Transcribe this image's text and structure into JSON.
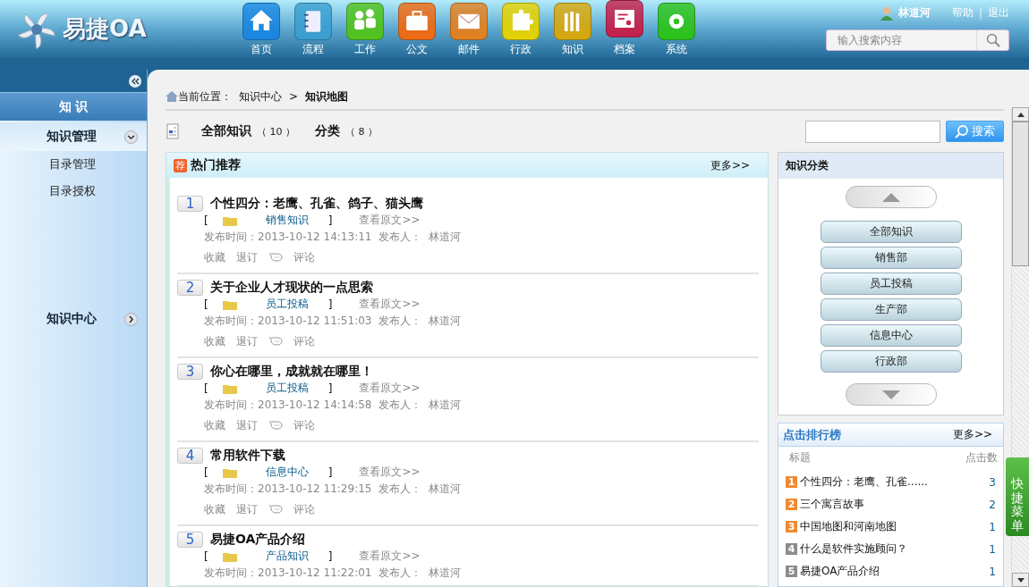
{
  "logo": {
    "text": "易捷OA"
  },
  "nav": [
    {
      "label": "首页",
      "color": "#1b86e0",
      "selected": false
    },
    {
      "label": "流程",
      "color": "#3a9fd0",
      "selected": false
    },
    {
      "label": "工作",
      "color": "#52c21c",
      "selected": false
    },
    {
      "label": "公文",
      "color": "#f06a12",
      "selected": false
    },
    {
      "label": "邮件",
      "color": "#e2801e",
      "selected": false
    },
    {
      "label": "行政",
      "color": "#e6d200",
      "selected": false
    },
    {
      "label": "知识",
      "color": "#d8a80c",
      "selected": false
    },
    {
      "label": "档案",
      "color": "#c4204a",
      "selected": true
    },
    {
      "label": "系统",
      "color": "#2cc21a",
      "selected": false
    }
  ],
  "user": {
    "name": "林道河"
  },
  "links": [
    "帮助",
    "退出"
  ],
  "link_divider": "|",
  "search": {
    "placeholder": "输入搜索内容"
  },
  "sidebar": {
    "title": "知 识",
    "sections": [
      {
        "label": "知识管理",
        "expanded": true,
        "items": [
          "目录管理",
          "目录授权"
        ]
      },
      {
        "label": "知识中心",
        "expanded": false
      }
    ]
  },
  "breadcrumb": {
    "prefix": "当前位置：",
    "path": [
      "知识中心",
      "知识地图"
    ],
    "separator": ">"
  },
  "summary": {
    "all_label": "全部知识",
    "all_count": "（ 10 ）",
    "category_label": "分类",
    "category_count": "（ 8 ）"
  },
  "search_button": "搜索",
  "hot": {
    "badge": "荐",
    "title": "热门推荐",
    "more": "更多>>",
    "items": [
      {
        "index": "1",
        "title": "个性四分：老鹰、孔雀、鸽子、猫头鹰",
        "open": "[",
        "category": "销售知识",
        "close": "]",
        "view": "查看原文>>",
        "time_label": "发布时间：",
        "time": "2013-10-12 14:13:11",
        "author_label": "发布人：",
        "author": "林道河",
        "actions": [
          "收藏",
          "退订",
          "评论"
        ]
      },
      {
        "index": "2",
        "title": "关于企业人才现状的一点思索",
        "open": "[",
        "category": "员工投稿",
        "close": "]",
        "view": "查看原文>>",
        "time_label": "发布时间：",
        "time": "2013-10-12 11:51:03",
        "author_label": "发布人：",
        "author": "林道河",
        "actions": [
          "收藏",
          "退订",
          "评论"
        ]
      },
      {
        "index": "3",
        "title": "你心在哪里，成就就在哪里！",
        "open": "[",
        "category": "员工投稿",
        "close": "]",
        "view": "查看原文>>",
        "time_label": "发布时间：",
        "time": "2013-10-12 14:14:58",
        "author_label": "发布人：",
        "author": "林道河",
        "actions": [
          "收藏",
          "退订",
          "评论"
        ]
      },
      {
        "index": "4",
        "title": "常用软件下载",
        "open": "[",
        "category": "信息中心",
        "close": "]",
        "view": "查看原文>>",
        "time_label": "发布时间：",
        "time": "2013-10-12 11:29:15",
        "author_label": "发布人：",
        "author": "林道河",
        "actions": [
          "收藏",
          "退订",
          "评论"
        ]
      },
      {
        "index": "5",
        "title": "易捷OA产品介绍",
        "open": "[",
        "category": "产品知识",
        "close": "]",
        "view": "查看原文>>",
        "time_label": "发布时间：",
        "time": "2013-10-12 11:22:01",
        "author_label": "发布人：",
        "author": "林道河"
      }
    ]
  },
  "categories": {
    "title": "知识分类",
    "items": [
      "全部知识",
      "销售部",
      "员工投稿",
      "生产部",
      "信息中心",
      "行政部"
    ]
  },
  "ranking": {
    "title": "点击排行榜",
    "more": "更多>>",
    "columns": [
      "标题",
      "点击数"
    ],
    "rows": [
      {
        "rank": "1",
        "title": "个性四分：老鹰、孔雀......",
        "count": "3",
        "color": "#f08a30"
      },
      {
        "rank": "2",
        "title": "三个寓言故事",
        "count": "2",
        "color": "#f08a30"
      },
      {
        "rank": "3",
        "title": "中国地图和河南地图",
        "count": "1",
        "color": "#f08a30"
      },
      {
        "rank": "4",
        "title": "什么是软件实施顾问？",
        "count": "1",
        "color": "#8c8c8c"
      },
      {
        "rank": "5",
        "title": "易捷OA产品介绍",
        "count": "1",
        "color": "#8c8c8c"
      }
    ]
  },
  "quick_menu": {
    "label": "快捷菜单"
  }
}
